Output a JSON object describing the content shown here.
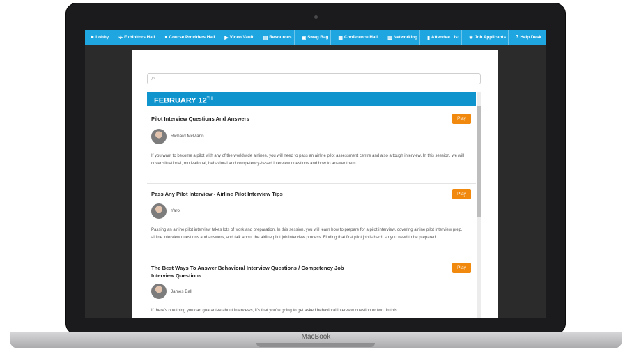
{
  "device": {
    "brand_label": "MacBook"
  },
  "nav": {
    "items": [
      {
        "icon": "⚑",
        "label": "Lobby"
      },
      {
        "icon": "✈",
        "label": "Exhibitors Hall"
      },
      {
        "icon": "●",
        "label": "Course Providers Hall"
      },
      {
        "icon": "▶",
        "label": "Video Vault"
      },
      {
        "icon": "▤",
        "label": "Resources"
      },
      {
        "icon": "▣",
        "label": "Swag Bag"
      },
      {
        "icon": "▦",
        "label": "Conference Hall"
      },
      {
        "icon": "▥",
        "label": "Networking"
      },
      {
        "icon": "▮",
        "label": "Attendee List"
      },
      {
        "icon": "★",
        "label": "Job Applicants"
      },
      {
        "icon": "?",
        "label": "Help Desk"
      }
    ]
  },
  "search": {
    "placeholder": ""
  },
  "date": {
    "label": "FEBRUARY 12",
    "suffix": "TH"
  },
  "sessions": [
    {
      "title": "Pilot Interview Questions And Answers",
      "speaker": "Richard McMann",
      "play_label": "Play",
      "description": "If you want to become a pilot with any of the worldwide airlines, you will need to pass an airline pilot assessment centre and also a tough interview. In this session, we will cover situational, motivational, behavioral and competency-based interview questions and how to answer them."
    },
    {
      "title": "Pass Any Pilot Interview - Airline Pilot Interview Tips",
      "speaker": "Yaro",
      "play_label": "Play",
      "description": "Passing an airline pilot interview takes lots of work and preparation. In this session, you will learn how to prepare for a pilot interview, covering airline pilot interview prep, airline interview questions and answers, and talk about the airline pilot job interview process. Finding that first pilot job is hard, so you need to be prepared."
    },
    {
      "title": "The Best Ways To Answer Behavioral Interview Questions / Competency Job Interview Questions",
      "speaker": "James Ball",
      "play_label": "Play",
      "description": "If there's one thing you can guarantee about interviews, it's that you're going to get asked behavioral interview question or two. In this"
    }
  ]
}
